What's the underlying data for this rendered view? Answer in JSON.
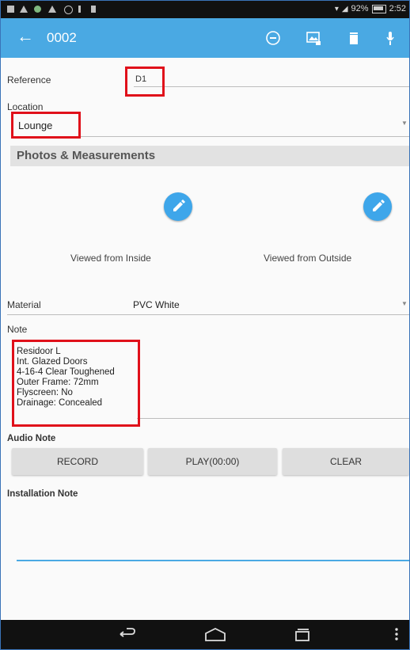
{
  "status_bar": {
    "battery": "92%",
    "time": "2:52"
  },
  "toolbar": {
    "title": "0002"
  },
  "reference": {
    "label": "Reference",
    "value": "D1"
  },
  "location": {
    "label": "Location",
    "value": "Lounge"
  },
  "photos": {
    "header": "Photos & Measurements",
    "inside_caption": "Viewed from Inside",
    "outside_caption": "Viewed from Outside"
  },
  "material": {
    "label": "Material",
    "value": "PVC White"
  },
  "note": {
    "label": "Note",
    "lines": [
      "Residoor L",
      "Int. Glazed Doors",
      "4-16-4 Clear Toughened",
      "Outer Frame: 72mm",
      "Flyscreen: No",
      "Drainage: Concealed"
    ]
  },
  "audio": {
    "label": "Audio Note",
    "record": "RECORD",
    "play": "PLAY(00:00)",
    "clear": "CLEAR"
  },
  "installation": {
    "label": "Installation Note",
    "value": ""
  },
  "colors": {
    "toolbar": "#4aa9e3",
    "fab": "#3ea6ea",
    "highlight": "#e0101a"
  }
}
